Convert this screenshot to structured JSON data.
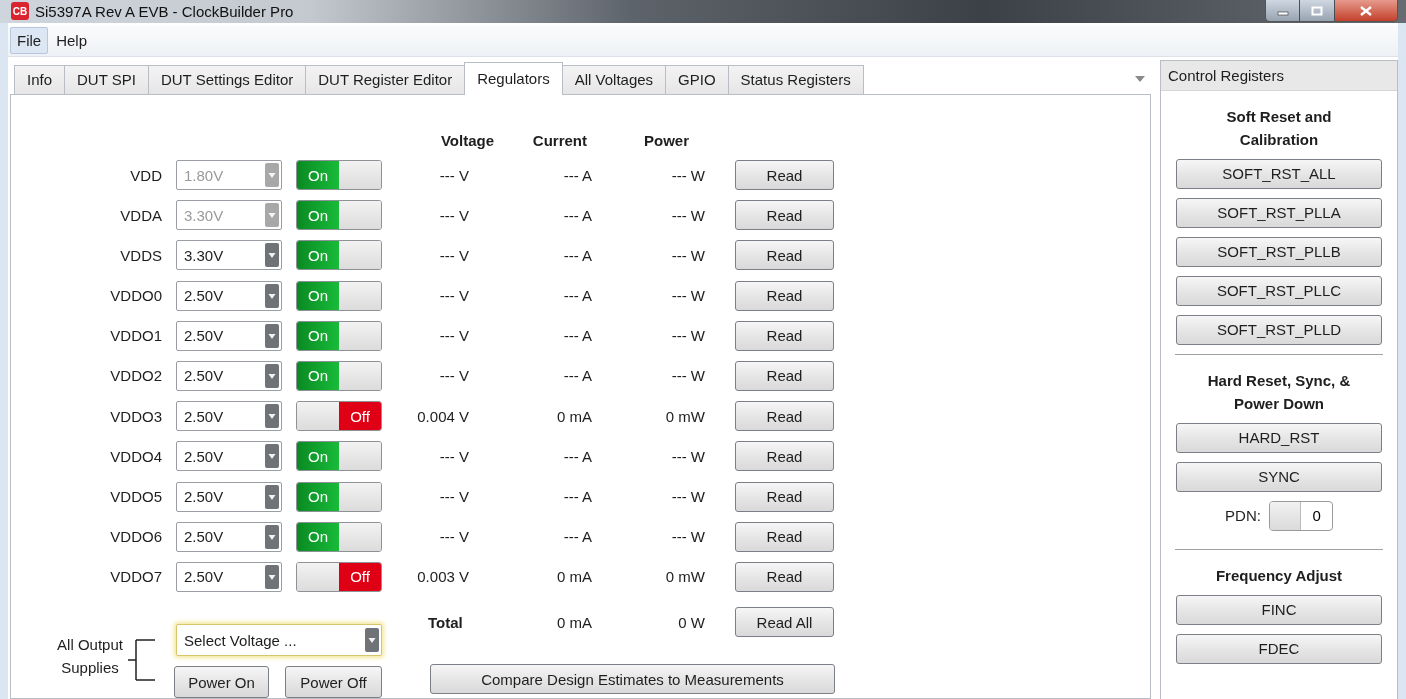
{
  "window": {
    "title": "Si5397A Rev A EVB - ClockBuilder Pro",
    "app_icon": "CB"
  },
  "menu": [
    {
      "label": "File",
      "selected": true
    },
    {
      "label": "Help",
      "selected": false
    }
  ],
  "tabs": [
    {
      "label": "Info",
      "selected": false
    },
    {
      "label": "DUT SPI",
      "selected": false
    },
    {
      "label": "DUT Settings Editor",
      "selected": false
    },
    {
      "label": "DUT Register Editor",
      "selected": false
    },
    {
      "label": "Regulators",
      "selected": true
    },
    {
      "label": "All Voltages",
      "selected": false
    },
    {
      "label": "GPIO",
      "selected": false
    },
    {
      "label": "Status Registers",
      "selected": false
    }
  ],
  "regulators": {
    "columns": [
      "Voltage",
      "Current",
      "Power"
    ],
    "rows": [
      {
        "name": "VDD",
        "setting": "1.80V",
        "disabled": true,
        "on": true,
        "toggle": "On",
        "voltage": "--- V",
        "current": "--- A",
        "power": "--- W",
        "button": "Read"
      },
      {
        "name": "VDDA",
        "setting": "3.30V",
        "disabled": true,
        "on": true,
        "toggle": "On",
        "voltage": "--- V",
        "current": "--- A",
        "power": "--- W",
        "button": "Read"
      },
      {
        "name": "VDDS",
        "setting": "3.30V",
        "disabled": false,
        "on": true,
        "toggle": "On",
        "voltage": "--- V",
        "current": "--- A",
        "power": "--- W",
        "button": "Read"
      },
      {
        "name": "VDDO0",
        "setting": "2.50V",
        "disabled": false,
        "on": true,
        "toggle": "On",
        "voltage": "--- V",
        "current": "--- A",
        "power": "--- W",
        "button": "Read"
      },
      {
        "name": "VDDO1",
        "setting": "2.50V",
        "disabled": false,
        "on": true,
        "toggle": "On",
        "voltage": "--- V",
        "current": "--- A",
        "power": "--- W",
        "button": "Read"
      },
      {
        "name": "VDDO2",
        "setting": "2.50V",
        "disabled": false,
        "on": true,
        "toggle": "On",
        "voltage": "--- V",
        "current": "--- A",
        "power": "--- W",
        "button": "Read"
      },
      {
        "name": "VDDO3",
        "setting": "2.50V",
        "disabled": false,
        "on": false,
        "toggle": "Off",
        "voltage": "0.004 V",
        "current": "0 mA",
        "power": "0 mW",
        "button": "Read"
      },
      {
        "name": "VDDO4",
        "setting": "2.50V",
        "disabled": false,
        "on": true,
        "toggle": "On",
        "voltage": "--- V",
        "current": "--- A",
        "power": "--- W",
        "button": "Read"
      },
      {
        "name": "VDDO5",
        "setting": "2.50V",
        "disabled": false,
        "on": true,
        "toggle": "On",
        "voltage": "--- V",
        "current": "--- A",
        "power": "--- W",
        "button": "Read"
      },
      {
        "name": "VDDO6",
        "setting": "2.50V",
        "disabled": false,
        "on": true,
        "toggle": "On",
        "voltage": "--- V",
        "current": "--- A",
        "power": "--- W",
        "button": "Read"
      },
      {
        "name": "VDDO7",
        "setting": "2.50V",
        "disabled": false,
        "on": false,
        "toggle": "Off",
        "voltage": "0.003 V",
        "current": "0 mA",
        "power": "0 mW",
        "button": "Read"
      }
    ],
    "total": {
      "label": "Total",
      "current": "0 mA",
      "power": "0 W",
      "button": "Read All"
    },
    "all_outputs": {
      "label": "All Output Supplies",
      "prompt": "Select Voltage ...",
      "focused": true,
      "buttons": [
        "Power On",
        "Power Off"
      ]
    },
    "compare_button": "Compare Design Estimates to Measurements"
  },
  "control_registers": {
    "title": "Control Registers",
    "sections": [
      {
        "title": "Soft Reset and Calibration",
        "buttons": [
          "SOFT_RST_ALL",
          "SOFT_RST_PLLA",
          "SOFT_RST_PLLB",
          "SOFT_RST_PLLC",
          "SOFT_RST_PLLD"
        ]
      },
      {
        "title": "Hard Reset, Sync, & Power Down",
        "buttons": [
          "HARD_RST",
          "SYNC"
        ],
        "pdn": {
          "label": "PDN:",
          "value": "0",
          "on": false
        }
      },
      {
        "title": "Frequency Adjust",
        "buttons": [
          "FINC",
          "FDEC"
        ]
      }
    ]
  }
}
